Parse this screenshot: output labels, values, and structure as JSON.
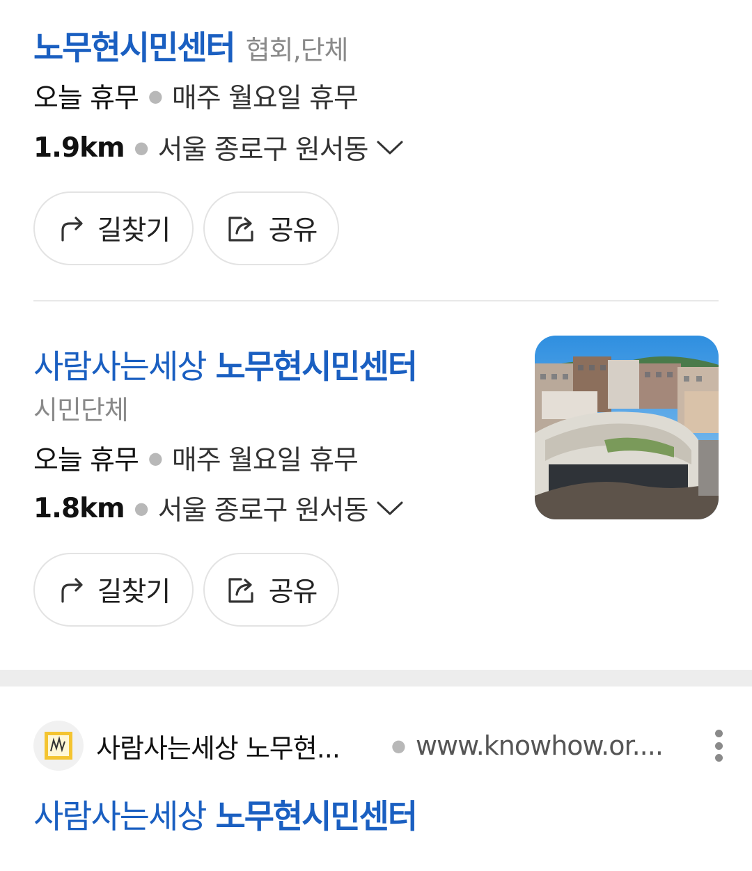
{
  "results": [
    {
      "title_strong": "노무현시민센터",
      "category": "협회,단체",
      "hours_status": "오늘 휴무",
      "hours_detail": "매주 월요일 휴무",
      "distance": "1.9km",
      "address": "서울 종로구 원서동",
      "directions_label": "길찾기",
      "share_label": "공유"
    },
    {
      "title_normal": "사람사는세상",
      "title_strong": "노무현시민센터",
      "category": "시민단체",
      "hours_status": "오늘 휴무",
      "hours_detail": "매주 월요일 휴무",
      "distance": "1.8km",
      "address": "서울 종로구 원서동",
      "directions_label": "길찾기",
      "share_label": "공유"
    }
  ],
  "web_result": {
    "site_name": "사람사는세상 노무현...",
    "site_url": "www.knowhow.or....",
    "title_normal": "사람사는세상",
    "title_strong": "노무현시민센터"
  },
  "colors": {
    "link_blue": "#1a5fc1",
    "muted_gray": "#8a8a8a",
    "divider": "#e8e8e8"
  },
  "icons": [
    "directions-arrow-icon",
    "share-icon",
    "chevron-down-icon",
    "more-vertical-icon",
    "site-favicon"
  ]
}
